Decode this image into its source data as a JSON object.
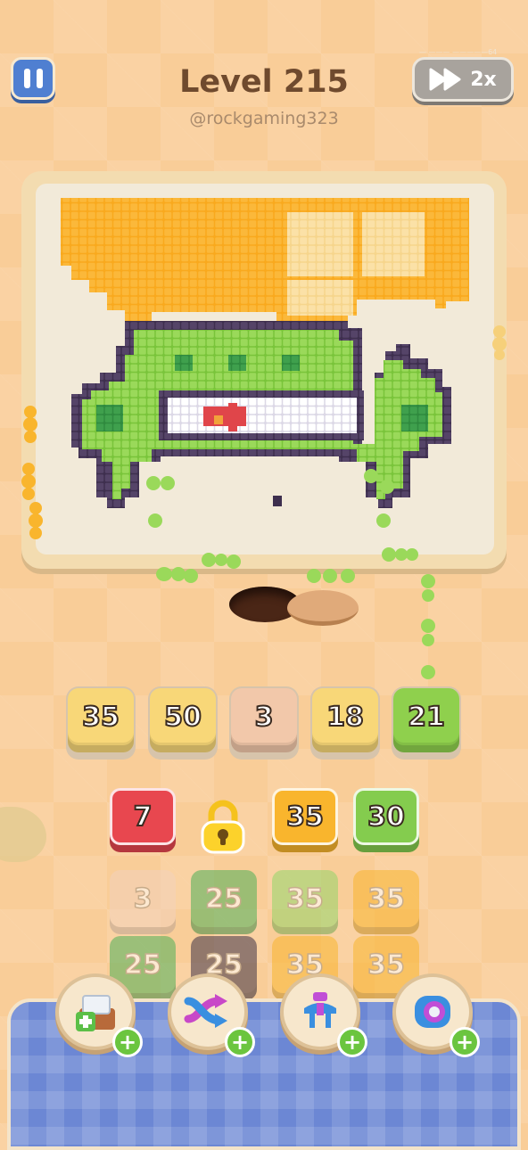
{
  "header": {
    "title": "Level 215",
    "subtitle": "@rockgaming323",
    "speed_label": "2x",
    "corner_text": "— ——— —————64"
  },
  "icons": {
    "pause": "pause-icon",
    "fast_forward": "fast-forward-icon",
    "lock": "padlock-icon",
    "boosters": [
      "add-tray-icon",
      "shuffle-icon",
      "magnet-claw-icon",
      "swap-icon"
    ]
  },
  "queue_tiles": [
    {
      "value": "35",
      "color": "#f8d778"
    },
    {
      "value": "50",
      "color": "#f8d778"
    },
    {
      "value": "3",
      "color": "#f2c8aa"
    },
    {
      "value": "18",
      "color": "#f8d778"
    },
    {
      "value": "21",
      "color": "#8fd04d"
    }
  ],
  "grid_rows": [
    [
      {
        "value": "7",
        "color": "#e8474f",
        "faded": false
      },
      {
        "locked": true
      },
      {
        "value": "35",
        "color": "#f9b52d",
        "faded": false
      },
      {
        "value": "30",
        "color": "#84cc4e",
        "faded": false
      }
    ],
    [
      {
        "value": "3",
        "color": "#f3d2bb",
        "faded": true
      },
      {
        "value": "25",
        "color": "#4fb157",
        "faded": true
      },
      {
        "value": "35",
        "color": "#94d66a",
        "faded": true
      },
      {
        "value": "35",
        "color": "#f9b52d",
        "faded": true
      }
    ],
    [
      {
        "value": "25",
        "color": "#4fb157",
        "faded": true
      },
      {
        "value": "25",
        "color": "#3f3448",
        "faded": true
      },
      {
        "value": "35",
        "color": "#f9b52d",
        "faded": true
      },
      {
        "value": "35",
        "color": "#f9b52d",
        "faded": true
      }
    ]
  ],
  "boosters": [
    {
      "name": "add-tray-booster",
      "plus": "+"
    },
    {
      "name": "shuffle-booster",
      "plus": "+"
    },
    {
      "name": "magnet-booster",
      "plus": "+"
    },
    {
      "name": "swap-booster",
      "plus": "+"
    }
  ],
  "colors": {
    "background": "#f9cd98",
    "accent_blue": "#4f7fd1",
    "picture_orange": "#f9a91d",
    "picture_green": "#8bd44a",
    "picture_outline": "#4b3a5c"
  }
}
